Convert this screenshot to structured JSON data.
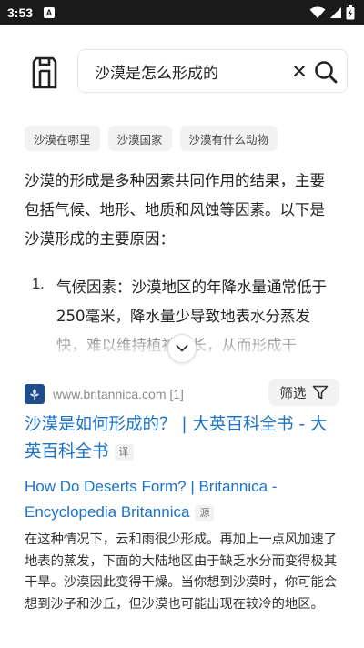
{
  "status_bar": {
    "time": "3:53",
    "notification_letter": "A"
  },
  "search": {
    "query": "沙漠是怎么形成的"
  },
  "suggestions": [
    "沙漠在哪里",
    "沙漠国家",
    "沙漠有什么动物"
  ],
  "answer": {
    "intro": "沙漠的形成是多种因素共同作用的结果，主要包括气候、地形、地质和风蚀等因素。以下是沙漠形成的主要原因：",
    "list": [
      {
        "number": "1.",
        "text": "气候因素：沙漠地区的年降水量通常低于250毫米，降水量少导致地表水分蒸发快，难以维持植被生长，从而形成干"
      }
    ]
  },
  "result": {
    "site_url": "www.britannica.com [1]",
    "filter_label": "筛选",
    "title": "沙漠是如何形成的？ | 大英百科全书 - 大英百科全书",
    "title_tag": "译",
    "subtitle": "How Do Deserts Form? | Britannica - Encyclopedia Britannica",
    "subtitle_tag": "源",
    "snippet": "在这种情况下，云和雨很少形成。再加上一点风加速了地表的蒸发，下面的大陆地区由于缺乏水分而变得极其干旱。沙漠因此变得干燥。当你想到沙漠时，你可能会想到沙子和沙丘，但沙漠也可能出现在较冷的地区。"
  },
  "colors": {
    "link": "#1a73c8",
    "chip_bg": "#f2f2f2",
    "status_bar": "#1a1a1a"
  }
}
